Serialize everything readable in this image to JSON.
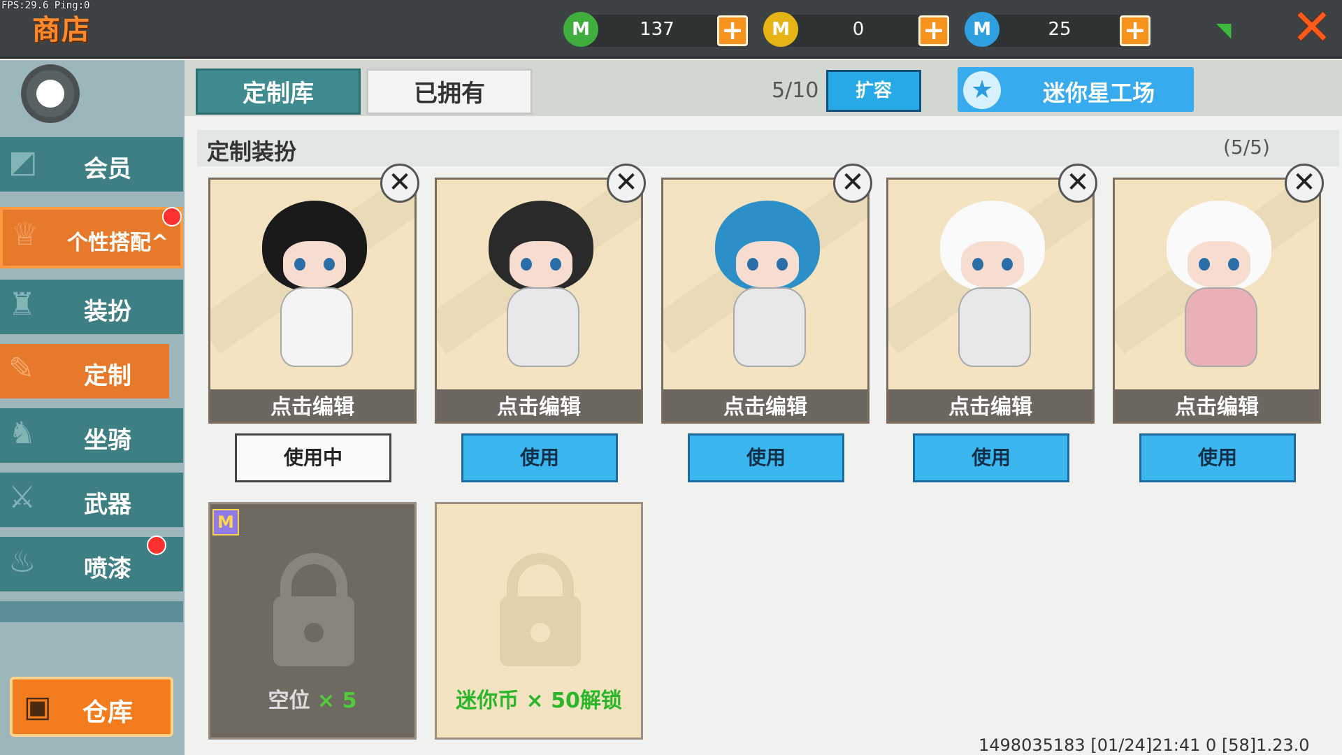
{
  "debug": "FPS:29.6 Ping:0",
  "header": {
    "title": "商店"
  },
  "currencies": [
    {
      "icon": "green-gem-icon",
      "symbol": "M",
      "value": "137",
      "color": "#3fae3f"
    },
    {
      "icon": "gold-coin-icon",
      "symbol": "M",
      "value": "0",
      "color": "#e6b515"
    },
    {
      "icon": "blue-star-coin-icon",
      "symbol": "M",
      "value": "25",
      "color": "#2f9fe0"
    }
  ],
  "plus_label": "+",
  "signal_icon": "wifi-signal-icon",
  "close_label": "✕",
  "sidebar": {
    "items": [
      {
        "label": "会员",
        "icon": "vip-icon",
        "active": false,
        "badge": false
      },
      {
        "label": "个性搭配^",
        "icon": "trophy-icon",
        "active": true,
        "badge": true
      },
      {
        "label": "装扮",
        "icon": "shirt-icon",
        "active": false,
        "badge": false
      },
      {
        "label": "定制",
        "icon": "pencil-icon",
        "active": true,
        "badge": false
      },
      {
        "label": "坐骑",
        "icon": "mount-icon",
        "active": false,
        "badge": false
      },
      {
        "label": "武器",
        "icon": "gun-icon",
        "active": false,
        "badge": false
      },
      {
        "label": "喷漆",
        "icon": "spray-can-icon",
        "active": false,
        "badge": true
      }
    ],
    "warehouse_label": "仓库"
  },
  "tabs": [
    {
      "label": "定制库",
      "active": true
    },
    {
      "label": "已拥有",
      "active": false
    }
  ],
  "capacity": "5/10",
  "expand_label": "扩容",
  "star_workshop_label": "迷你星工场",
  "section": {
    "title": "定制装扮",
    "count": "(5/5)"
  },
  "edit_label": "点击编辑",
  "cards": [
    {
      "use_label": "使用中",
      "in_use": true,
      "hair": "#1a1a1a",
      "body": "#f4f4f4"
    },
    {
      "use_label": "使用",
      "in_use": false,
      "hair": "#2a2a2a",
      "body": "#e8e8ea"
    },
    {
      "use_label": "使用",
      "in_use": false,
      "hair": "#2d8fc8",
      "body": "#e8e8ea"
    },
    {
      "use_label": "使用",
      "in_use": false,
      "hair": "#fafafa",
      "body": "#e8e8ea"
    },
    {
      "use_label": "使用",
      "in_use": false,
      "hair": "#fafafa",
      "body": "#e9b0b8"
    }
  ],
  "slots": [
    {
      "prefix": "空位 ",
      "suffix": "× 5",
      "style": "dark",
      "badge": "M"
    },
    {
      "prefix": "迷你币 × 50解锁",
      "suffix": "",
      "style": "light",
      "badge": ""
    }
  ],
  "footer": "1498035183   [01/24]21:41 0   [58]1.23.0"
}
